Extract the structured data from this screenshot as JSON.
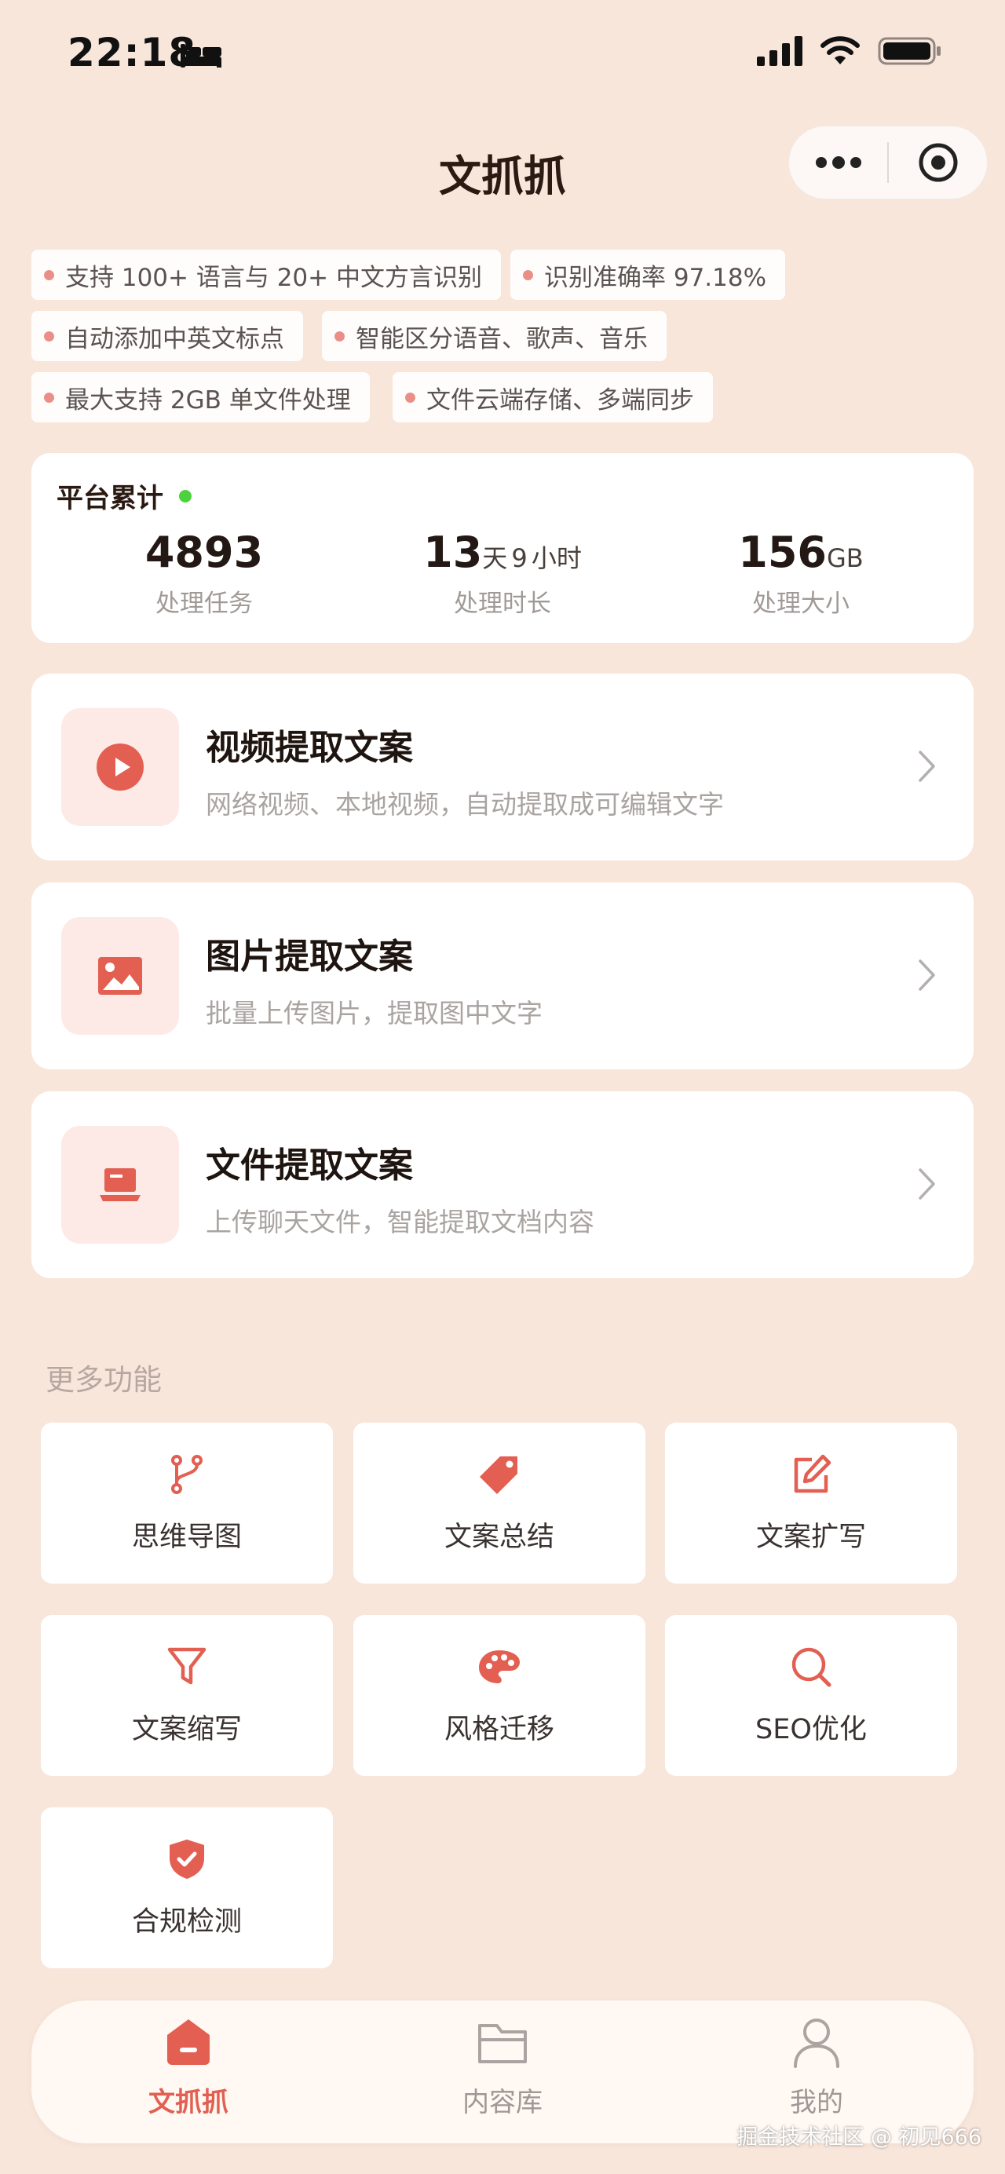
{
  "status_bar": {
    "time": "22:18"
  },
  "nav": {
    "title": "文抓抓"
  },
  "tags": [
    "支持 100+ 语言与 20+ 中文方言识别",
    "识别准确率 97.18%",
    "自动添加中英文标点",
    "智能区分语音、歌声、音乐",
    "最大支持 2GB 单文件处理",
    "文件云端存储、多端同步"
  ],
  "stats": {
    "title": "平台累计",
    "tasks": {
      "value": "4893",
      "label": "处理任务"
    },
    "duration": {
      "days": "13",
      "days_unit": "天",
      "hours": "9",
      "hours_unit": "小时",
      "label": "处理时长"
    },
    "size": {
      "value": "156",
      "unit": "GB",
      "label": "处理大小"
    }
  },
  "features": [
    {
      "icon": "play-icon",
      "title": "视频提取文案",
      "desc": "网络视频、本地视频，自动提取成可编辑文字"
    },
    {
      "icon": "image-icon",
      "title": "图片提取文案",
      "desc": "批量上传图片，提取图中文字"
    },
    {
      "icon": "laptop-icon",
      "title": "文件提取文案",
      "desc": "上传聊天文件，智能提取文档内容"
    }
  ],
  "more": {
    "title": "更多功能",
    "tools": [
      {
        "icon": "branch-icon",
        "label": "思维导图"
      },
      {
        "icon": "tag-icon",
        "label": "文案总结"
      },
      {
        "icon": "edit-icon",
        "label": "文案扩写"
      },
      {
        "icon": "filter-icon",
        "label": "文案缩写"
      },
      {
        "icon": "palette-icon",
        "label": "风格迁移"
      },
      {
        "icon": "search-icon",
        "label": "SEO优化"
      },
      {
        "icon": "shield-check-icon",
        "label": "合规检测"
      }
    ]
  },
  "tabbar": {
    "items": [
      {
        "icon": "home-icon",
        "label": "文抓抓",
        "active": true
      },
      {
        "icon": "folder-icon",
        "label": "内容库",
        "active": false
      },
      {
        "icon": "user-icon",
        "label": "我的",
        "active": false
      }
    ]
  },
  "watermark": "掘金技术社区 @ 初见666",
  "colors": {
    "accent": "#e25f52",
    "background": "#f8e6db",
    "icon_bg": "#fde9e6",
    "live": "#4cd23c"
  }
}
